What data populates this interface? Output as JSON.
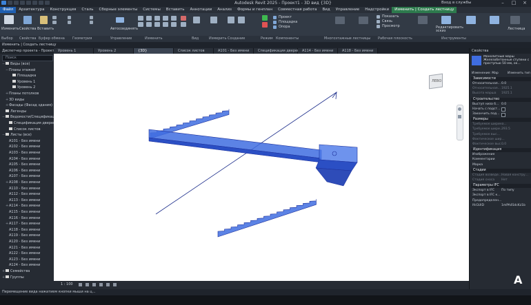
{
  "title": "Autodesk Revit 2025 - Проект1 - 3D вид {3D}",
  "user": "Вход в службы",
  "menu": [
    {
      "label": "Файл",
      "style": "active"
    },
    {
      "label": "Архитектура",
      "style": ""
    },
    {
      "label": "Конструкция",
      "style": ""
    },
    {
      "label": "Сталь",
      "style": ""
    },
    {
      "label": "Сборные элементы",
      "style": ""
    },
    {
      "label": "Системы",
      "style": ""
    },
    {
      "label": "Вставить",
      "style": ""
    },
    {
      "label": "Аннотации",
      "style": ""
    },
    {
      "label": "Анализ",
      "style": ""
    },
    {
      "label": "Формы и генплан",
      "style": ""
    },
    {
      "label": "Совместная работа",
      "style": ""
    },
    {
      "label": "Вид",
      "style": ""
    },
    {
      "label": "Управление",
      "style": ""
    },
    {
      "label": "Надстройки",
      "style": ""
    },
    {
      "label": "Изменить | Создать лестницу",
      "style": "ctx"
    }
  ],
  "ribbon": {
    "modify": "Изменить",
    "properties": "Свойства",
    "paste": "Вставить",
    "cut_clipboard": "Буфер обмена",
    "autoconnect": "Автосоединять",
    "project_btn": "Проект",
    "landing_btn": "Площадка",
    "support_btn": "Опора",
    "show_btn": "Показать",
    "link_btn": "Связь",
    "viewer_btn": "Просмотр",
    "edit_btn": "Редактировать эскиз",
    "stairs_btn": "Лестница",
    "panels": [
      "Выбор",
      "Свойства",
      "Буфер обмена",
      "Геометрия",
      "Управление",
      "Изменить",
      "Вид",
      "Измерить",
      "Создание",
      "Режим",
      "Компоненты",
      "Многоэтажные лестницы",
      "Рабочая плоскость",
      "Инструменты"
    ]
  },
  "context_line": "Изменить | Создать лестницу",
  "project_browser": {
    "title": "Диспетчер проекта - Проект1",
    "search_placeholder": "Поиск",
    "items": [
      {
        "label": "Виды (все)",
        "level": 0,
        "ex": "−",
        "icon": true
      },
      {
        "label": "Планы этажей",
        "level": 1,
        "ex": "−",
        "icon": false
      },
      {
        "label": "Площадка",
        "level": 2,
        "ex": "",
        "icon": true
      },
      {
        "label": "Уровень 1",
        "level": 2,
        "ex": "",
        "icon": true
      },
      {
        "label": "Уровень 2",
        "level": 2,
        "ex": "",
        "icon": true
      },
      {
        "label": "Планы потолков",
        "level": 1,
        "ex": "+",
        "icon": false
      },
      {
        "label": "3D виды",
        "level": 1,
        "ex": "+",
        "icon": false
      },
      {
        "label": "Фасады (Фасад здания)",
        "level": 1,
        "ex": "+",
        "icon": false
      },
      {
        "label": "Легенды",
        "level": 0,
        "ex": "",
        "icon": true
      },
      {
        "label": "Ведомости/Спецификации",
        "level": 0,
        "ex": "−",
        "icon": true
      },
      {
        "label": "Спецификация дверей",
        "level": 1,
        "ex": "",
        "icon": true
      },
      {
        "label": "Список листов",
        "level": 1,
        "ex": "",
        "icon": true
      },
      {
        "label": "Листы (все)",
        "level": 0,
        "ex": "−",
        "icon": true
      },
      {
        "label": "A101 - Без имени",
        "level": 1,
        "ex": "",
        "icon": false
      },
      {
        "label": "A102 - Без имени",
        "level": 1,
        "ex": "",
        "icon": false
      },
      {
        "label": "A103 - Без имени",
        "level": 1,
        "ex": "",
        "icon": false
      },
      {
        "label": "A104 - Без имени",
        "level": 1,
        "ex": "",
        "icon": false
      },
      {
        "label": "A105 - Без имени",
        "level": 1,
        "ex": "",
        "icon": false
      },
      {
        "label": "A106 - Без имени",
        "level": 1,
        "ex": "",
        "icon": false
      },
      {
        "label": "A107 - Без имени",
        "level": 1,
        "ex": "",
        "icon": false
      },
      {
        "label": "A108 - Без имени",
        "level": 1,
        "ex": "+",
        "icon": false
      },
      {
        "label": "A110 - Без имени",
        "level": 1,
        "ex": "",
        "icon": false
      },
      {
        "label": "A112 - Без имени",
        "level": 1,
        "ex": "",
        "icon": false
      },
      {
        "label": "A113 - Без имени",
        "level": 1,
        "ex": "",
        "icon": false
      },
      {
        "label": "A114 - Без имени",
        "level": 1,
        "ex": "+",
        "icon": false
      },
      {
        "label": "A115 - Без имени",
        "level": 1,
        "ex": "",
        "icon": false
      },
      {
        "label": "A116 - Без имени",
        "level": 1,
        "ex": "",
        "icon": false
      },
      {
        "label": "A117 - Без имени",
        "level": 1,
        "ex": "+",
        "icon": false
      },
      {
        "label": "A118 - Без имени",
        "level": 1,
        "ex": "",
        "icon": false
      },
      {
        "label": "A119 - Без имени",
        "level": 1,
        "ex": "",
        "icon": false
      },
      {
        "label": "A120 - Без имени",
        "level": 1,
        "ex": "",
        "icon": false
      },
      {
        "label": "A121 - Без имени",
        "level": 1,
        "ex": "",
        "icon": false
      },
      {
        "label": "A122 - Без имени",
        "level": 1,
        "ex": "",
        "icon": false
      },
      {
        "label": "A123 - Без имени",
        "level": 1,
        "ex": "",
        "icon": false
      },
      {
        "label": "A124 - Без имени",
        "level": 1,
        "ex": "",
        "icon": false
      },
      {
        "label": "Семейства",
        "level": 0,
        "ex": "+",
        "icon": true
      },
      {
        "label": "Группы",
        "level": 0,
        "ex": "+",
        "icon": true
      }
    ]
  },
  "tabs": [
    {
      "label": "Уровень 1",
      "active": false
    },
    {
      "label": "Уровень 2",
      "active": false
    },
    {
      "label": "{3D}",
      "active": true
    },
    {
      "label": "Список листов",
      "active": false
    },
    {
      "label": "A101 - Без имени",
      "active": false
    },
    {
      "label": "Спецификация дверей",
      "active": false
    },
    {
      "label": "A114 - Без имени",
      "active": false
    },
    {
      "label": "A118 - Без имени",
      "active": false
    }
  ],
  "viewcube_label": "ЛЕВО",
  "view_scale": "1 : 100",
  "properties": {
    "title": "Свойства",
    "type_text": "Монолитный марш Железобетонные ступени с проступью 50 мм, ок...",
    "selector_left": "Изменение: Мар",
    "selector_right": "Изменить тип",
    "sections": [
      {
        "name": "Зависимости",
        "rows": [
          {
            "k": "Относительная...",
            "v": "0.0",
            "dim": false,
            "cb": false
          },
          {
            "k": "Относительная...",
            "v": "1925.1",
            "dim": true,
            "cb": false
          },
          {
            "k": "Высота марша",
            "v": "1925.1",
            "dim": true,
            "cb": false
          }
        ]
      },
      {
        "name": "Строительство",
        "rows": [
          {
            "k": "Выступ низа б...",
            "v": "0.0",
            "dim": false,
            "cb": false
          },
          {
            "k": "Начать с подст...",
            "v": "",
            "dim": false,
            "cb": true
          },
          {
            "k": "Закончить под...",
            "v": "",
            "dim": false,
            "cb": true
          }
        ]
      },
      {
        "name": "Размеры",
        "rows": [
          {
            "k": "Требуемое ширина...",
            "v": "",
            "dim": true,
            "cb": false
          },
          {
            "k": "Требуемое шири...",
            "v": "293.5",
            "dim": true,
            "cb": false
          },
          {
            "k": "Требуемое выс...",
            "v": "",
            "dim": true,
            "cb": false
          },
          {
            "k": "Фактическое шир...",
            "v": "",
            "dim": true,
            "cb": false
          },
          {
            "k": "Фактическое выс...",
            "v": "0.0",
            "dim": true,
            "cb": false
          }
        ]
      },
      {
        "name": "Идентификация",
        "rows": [
          {
            "k": "Изображение",
            "v": "",
            "dim": false,
            "cb": false
          },
          {
            "k": "Комментарии",
            "v": "",
            "dim": false,
            "cb": false
          },
          {
            "k": "Марка",
            "v": "",
            "dim": false,
            "cb": false
          }
        ]
      },
      {
        "name": "Стадии",
        "rows": [
          {
            "k": "Стадия возведе...",
            "v": "Новая констру...",
            "dim": true,
            "cb": false
          },
          {
            "k": "Стадия сноса",
            "v": "Нет",
            "dim": true,
            "cb": false
          }
        ]
      },
      {
        "name": "Параметры IFC",
        "rows": [
          {
            "k": "Экспорт в IFC",
            "v": "По типу",
            "dim": false,
            "cb": false
          },
          {
            "k": "Экспорт в IFC к...",
            "v": "",
            "dim": false,
            "cb": false
          },
          {
            "k": "Предопределен...",
            "v": "",
            "dim": false,
            "cb": false
          },
          {
            "k": "IfcGUID",
            "v": "1mPA4SdcKz1b",
            "dim": false,
            "cb": false
          }
        ]
      }
    ]
  },
  "status_text": "Перемещение вида нажатием кнопки мыши на ц...",
  "watermark": "A",
  "colors": {
    "accent": "#1f5fb0",
    "stair_fill": "#3f6de0",
    "stair_edge": "#1c2f9a"
  }
}
